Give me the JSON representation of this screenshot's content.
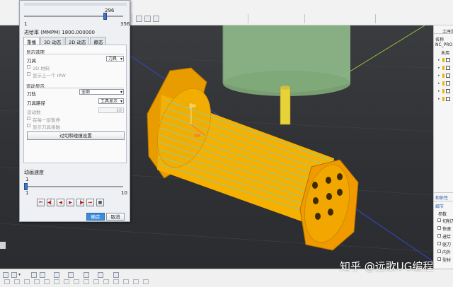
{
  "slider": {
    "value": "296",
    "min": "1",
    "max": "356",
    "fraction": 0.83
  },
  "feed_rate_label": "进给率 (MMPM) 1800.000000",
  "tabs": [
    {
      "label": "重播",
      "active": true
    },
    {
      "label": "3D 动态",
      "active": false
    },
    {
      "label": "2D 动态",
      "active": false
    },
    {
      "label": "静态",
      "active": false
    }
  ],
  "display_options": {
    "section": "显示选项",
    "tool_label": "刀具",
    "tool_value": "刀具",
    "chk_2d_material": "2D 材料",
    "chk_show_ipw": "显示上一个 IPW"
  },
  "motion_display": {
    "section": "运动显示",
    "toolpath_label": "刀轨",
    "toolpath_value": "全部",
    "tool_display_label": "刀具路径",
    "tool_display_value": "工具显示",
    "motion_count_label": "运动数",
    "motion_count_value": "10",
    "chk_pause_each": "在每一层暂停",
    "chk_show_tool_contact": "显示刀具接触"
  },
  "cut_settings_button": "过切和碰撞设置",
  "animation_speed": {
    "label": "动画速度",
    "value": "1",
    "min": "1",
    "max": "10",
    "fraction": 0.0
  },
  "transport_buttons": [
    "go-start",
    "step-back",
    "play-reverse",
    "play",
    "step-forward",
    "go-end",
    "stop"
  ],
  "ok_label": "确定",
  "cancel_label": "取消",
  "navigator": {
    "title": "工序导",
    "name_label": "名称",
    "root": "NC_PRO",
    "root_child": "未用",
    "related_label": "相依性",
    "details_label": "细节",
    "params_label": "参数",
    "params": [
      "切削刀",
      "快速",
      "进给",
      "驱刀",
      "内外",
      "型材"
    ]
  },
  "watermark": "知乎 @远歌UG编程",
  "colors": {
    "part_orange": "#f5a800",
    "part_dark": "#c98400",
    "toolpath_cyan": "#5fd8ee",
    "tool_green": "#8fb98a",
    "accent_blue": "#3d8cdb"
  },
  "viewport_labels": {
    "zm": "ZM",
    "xm": "XM"
  }
}
